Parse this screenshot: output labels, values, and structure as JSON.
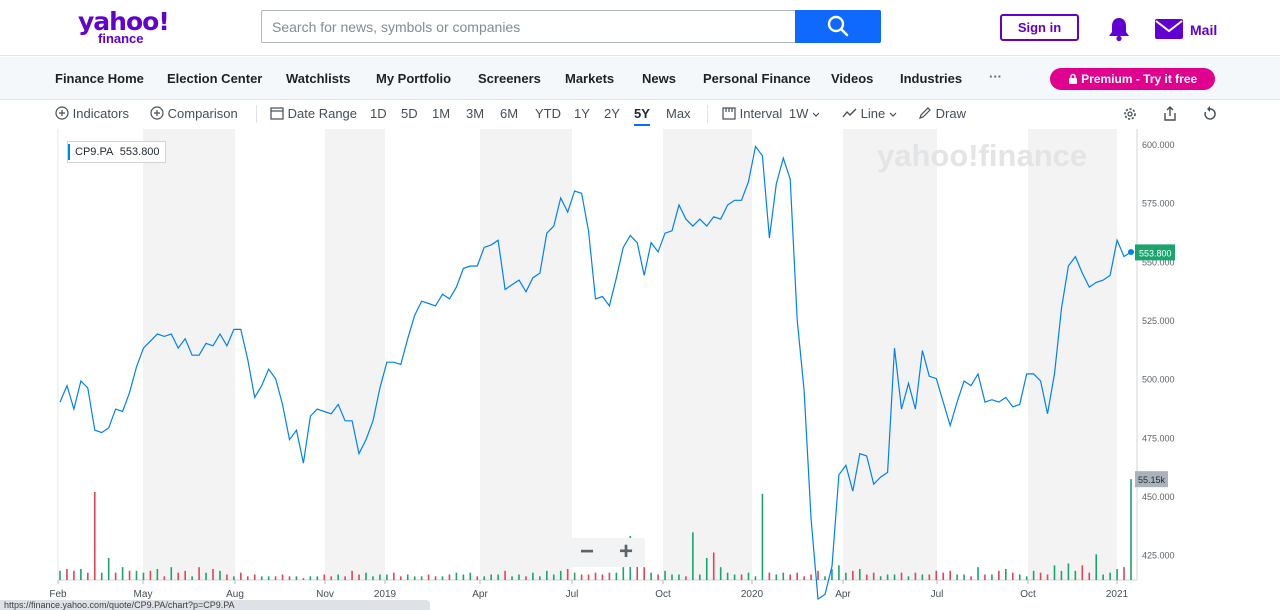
{
  "header": {
    "logo_top": "yahoo!",
    "logo_bottom": "finance",
    "search_placeholder": "Search for news, symbols or companies",
    "signin": "Sign in",
    "mail": "Mail"
  },
  "nav": {
    "items": [
      "Finance Home",
      "Election Center",
      "Watchlists",
      "My Portfolio",
      "Screeners",
      "Markets",
      "News",
      "Personal Finance",
      "Videos",
      "Industries"
    ],
    "more": "···",
    "premium": "Premium - Try it free"
  },
  "toolbar": {
    "indicators": "Indicators",
    "comparison": "Comparison",
    "date_range": "Date Range",
    "ranges": [
      "1D",
      "5D",
      "1M",
      "3M",
      "6M",
      "YTD",
      "1Y",
      "2Y",
      "5Y",
      "Max"
    ],
    "active_range": "5Y",
    "interval": "Interval",
    "interval_value": "1W",
    "chart_type": "Line",
    "draw": "Draw"
  },
  "ticker_label": {
    "symbol": "CP9.PA",
    "value": "553.800"
  },
  "watermark": "yahoo!finance",
  "zoom": {
    "minus": "−",
    "plus": "+"
  },
  "status_url": "https://finance.yahoo.com/quote/CP9.PA/chart?p=CP9.PA",
  "colors": {
    "line": "#0081f2",
    "up": "#1ba56e",
    "down": "#e04556",
    "price_tag": "#1ba56e",
    "volume_tag": "#aab3bb"
  },
  "chart_data": {
    "type": "line",
    "title": "",
    "xlabel": "",
    "ylabel": "",
    "x_tick_labels": [
      "Feb",
      "May",
      "Aug",
      "Nov",
      "2019",
      "Apr",
      "Jul",
      "Oct",
      "2020",
      "Apr",
      "Jul",
      "Oct",
      "2021"
    ],
    "y_tick_labels": [
      "600.000",
      "575.000",
      "550.000",
      "525.000",
      "500.000",
      "475.000",
      "450.000",
      "425.000"
    ],
    "ylim": [
      415,
      603
    ],
    "current_price_label": "553.800",
    "current_volume_label": "55.15k",
    "grid": "alternating vertical bands",
    "series": [
      {
        "type": "line",
        "values": [
          490,
          497,
          487,
          499,
          496,
          478,
          477,
          479,
          487,
          486,
          494,
          505,
          513,
          516,
          519,
          518,
          519,
          513,
          517,
          510,
          510,
          515,
          514,
          519,
          514,
          521,
          521,
          508,
          492,
          497,
          504,
          500,
          489,
          474,
          478,
          464,
          484,
          487,
          486,
          485,
          489,
          482,
          482,
          468,
          474,
          482,
          496,
          507,
          507,
          506,
          517,
          527,
          533,
          532,
          531,
          536,
          534,
          539,
          547,
          548,
          548,
          556,
          557,
          559,
          538,
          540,
          542,
          537,
          543,
          545,
          562,
          565,
          577,
          571,
          580,
          579,
          563,
          534,
          535,
          531,
          543,
          556,
          561,
          558,
          544,
          558,
          554,
          562,
          563,
          574,
          568,
          565,
          568,
          565,
          569,
          568,
          574,
          576,
          576,
          584,
          599,
          595,
          560,
          583,
          594,
          585,
          525,
          495,
          440,
          406,
          408,
          420,
          459,
          463,
          452,
          468,
          467,
          455,
          458,
          460,
          513,
          487,
          498,
          487,
          512,
          501,
          500,
          490,
          480,
          490,
          499,
          497,
          502,
          490,
          491,
          490,
          492,
          488,
          489,
          502,
          502,
          499,
          485,
          502,
          530,
          548,
          552,
          545,
          539,
          541,
          542,
          544,
          559,
          552,
          554
        ]
      }
    ],
    "volume": {
      "unit": "k",
      "values": [
        5,
        6,
        5,
        6,
        4,
        48,
        4,
        12,
        4,
        7,
        5,
        5,
        4,
        5,
        6,
        2,
        7,
        4,
        5,
        2,
        7,
        4,
        6,
        5,
        3,
        2,
        4,
        2,
        3,
        2,
        2,
        2,
        3,
        2,
        2,
        1,
        2,
        2,
        3,
        2,
        3,
        2,
        5,
        3,
        4,
        2,
        3,
        3,
        4,
        2,
        3,
        2,
        2,
        3,
        2,
        2,
        3,
        4,
        3,
        4,
        2,
        2,
        3,
        3,
        5,
        2,
        3,
        2,
        4,
        2,
        5,
        3,
        5,
        6,
        4,
        3,
        3,
        4,
        3,
        4,
        4,
        7,
        24,
        13,
        7,
        4,
        3,
        5,
        3,
        3,
        2,
        26,
        3,
        12,
        15,
        7,
        4,
        3,
        3,
        4,
        2,
        47,
        4,
        3,
        4,
        3,
        4,
        2,
        3,
        5,
        2,
        6,
        8,
        4,
        5,
        6,
        3,
        4,
        2,
        3,
        3,
        4,
        2,
        4,
        3,
        3,
        5,
        4,
        5,
        3,
        3,
        2,
        7,
        3,
        3,
        5,
        6,
        4,
        3,
        2,
        5,
        4,
        3,
        8,
        5,
        9,
        5,
        8,
        4,
        14,
        3,
        4,
        6,
        7,
        55
      ],
      "up": [
        1,
        0,
        0,
        1,
        0,
        0,
        1,
        1,
        0,
        1,
        0,
        1,
        1,
        0,
        1,
        0,
        1,
        0,
        0,
        1,
        0,
        1,
        0,
        1,
        0,
        1,
        0,
        0,
        0,
        1,
        1,
        0,
        0,
        0,
        1,
        0,
        1,
        1,
        0,
        0,
        1,
        0,
        0,
        0,
        1,
        1,
        1,
        1,
        0,
        0,
        1,
        1,
        1,
        0,
        0,
        1,
        0,
        1,
        1,
        1,
        0,
        1,
        1,
        1,
        0,
        1,
        1,
        0,
        1,
        1,
        1,
        1,
        1,
        0,
        1,
        0,
        0,
        0,
        0,
        0,
        1,
        1,
        1,
        0,
        0,
        1,
        0,
        1,
        1,
        1,
        0,
        1,
        1,
        1,
        0,
        1,
        1,
        1,
        0,
        1,
        1,
        1,
        0,
        1,
        1,
        0,
        0,
        0,
        0,
        0,
        1,
        1,
        1,
        1,
        0,
        1,
        0,
        0,
        1,
        1,
        1,
        0,
        1,
        0,
        1,
        0,
        0,
        0,
        0,
        1,
        1,
        0,
        1,
        0,
        1,
        0,
        1,
        0,
        1,
        1,
        1,
        0,
        0,
        1,
        1,
        1,
        1,
        0,
        0,
        1,
        1,
        1,
        1,
        0,
        1
      ]
    }
  }
}
